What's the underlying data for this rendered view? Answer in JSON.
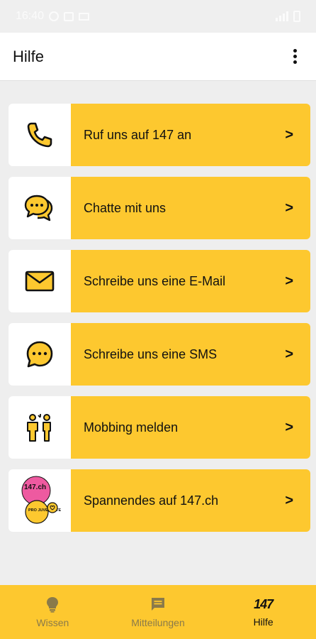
{
  "status_bar": {
    "time": "16:40"
  },
  "app_bar": {
    "title": "Hilfe",
    "menu_icon": "more-vert-icon"
  },
  "items": [
    {
      "label": "Ruf uns auf 147 an",
      "icon": "phone-icon"
    },
    {
      "label": "Chatte mit uns",
      "icon": "chat-bubbles-icon"
    },
    {
      "label": "Schreibe uns eine E-Mail",
      "icon": "envelope-icon"
    },
    {
      "label": "Schreibe uns eine SMS",
      "icon": "sms-bubble-icon"
    },
    {
      "label": "Mobbing melden",
      "icon": "mobbing-people-icon"
    },
    {
      "label": "Spannendes auf 147.ch",
      "icon": "stickers-icon",
      "sticker_text": [
        "147.ch",
        "PRO JUVENTUTE"
      ]
    }
  ],
  "chevron": ">",
  "bottom_nav": {
    "items": [
      {
        "label": "Wissen",
        "icon": "lightbulb-icon",
        "active": false
      },
      {
        "label": "Mitteilungen",
        "icon": "message-icon",
        "active": false
      },
      {
        "label": "Hilfe",
        "icon": "147-logo-icon",
        "logo_text": "147",
        "active": true
      }
    ]
  },
  "colors": {
    "accent": "#fdc82f",
    "background": "#eeeeee",
    "card": "#ffffff",
    "text": "#111111"
  }
}
